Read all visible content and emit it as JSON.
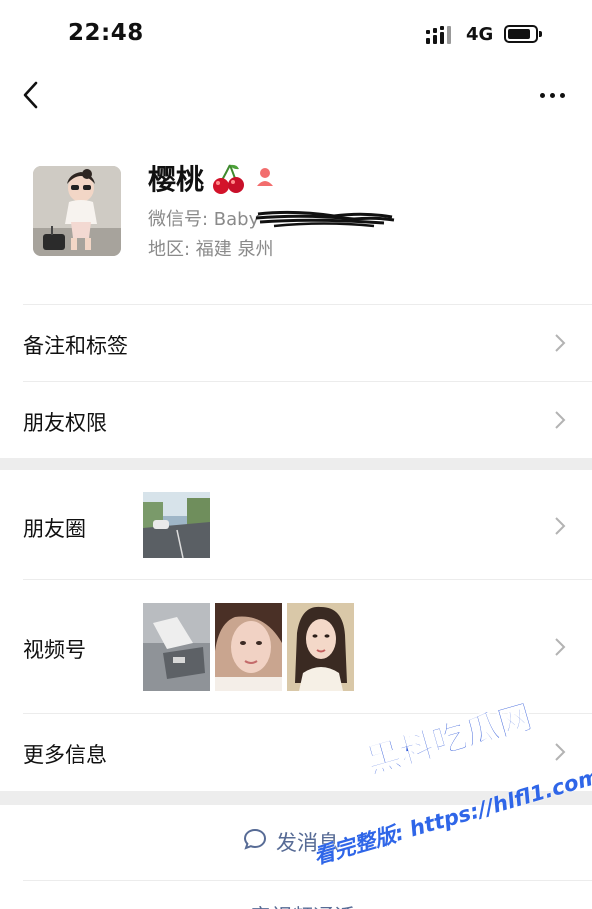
{
  "status_bar": {
    "time": "22:48",
    "network": "4G",
    "signal_icon": "signal-bars-icon",
    "battery_icon": "battery-icon"
  },
  "nav": {
    "back_icon": "chevron-left-icon",
    "more_icon": "ellipsis-icon"
  },
  "profile": {
    "nickname": "樱桃",
    "nickname_emoji_icon": "cherry-icon",
    "gender_icon": "female-icon",
    "wechat_id_prefix": "微信号: Baby",
    "region": "地区: 福建 泉州"
  },
  "rows": {
    "remarks_tags": "备注和标签",
    "friend_permissions": "朋友权限",
    "moments": "朋友圈",
    "channels": "视频号",
    "more_info": "更多信息"
  },
  "actions": {
    "send_message": "发消息",
    "send_message_icon": "chat-bubble-icon",
    "call_partial": "音视频通话"
  },
  "watermark": {
    "brand": "黑料吃瓜网",
    "url": "看完整版: https://hlfl1.com"
  },
  "colors": {
    "link": "#576b95",
    "section_gap": "#ededed",
    "watermark": "#2c56d8"
  }
}
